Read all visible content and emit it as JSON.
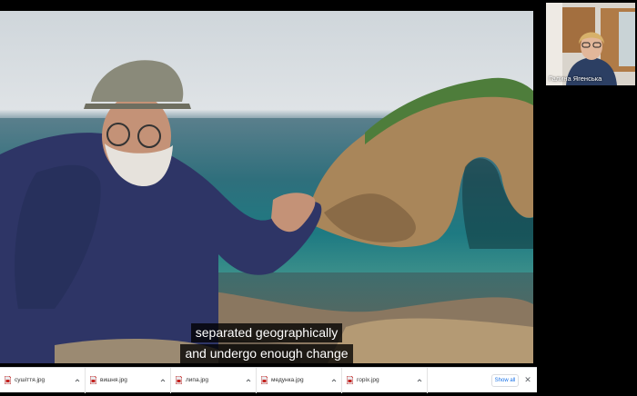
{
  "video": {
    "subtitle_line_1": "separated geographically",
    "subtitle_line_2": "and undergo enough change"
  },
  "participant": {
    "name": "Галина Ягенська"
  },
  "downloads": {
    "items": [
      {
        "file_name": "сушіття.jpg",
        "icon": "image-file-icon"
      },
      {
        "file_name": "вишня.jpg",
        "icon": "image-file-icon"
      },
      {
        "file_name": "липа.jpg",
        "icon": "image-file-icon"
      },
      {
        "file_name": "медунка.jpg",
        "icon": "image-file-icon"
      },
      {
        "file_name": "горіх.jpg",
        "icon": "image-file-icon"
      }
    ],
    "show_all_label": "Show all",
    "close_label": "✕"
  },
  "colors": {
    "background": "#000000",
    "download_bar": "#ffffff",
    "link_blue": "#1a73e8"
  }
}
